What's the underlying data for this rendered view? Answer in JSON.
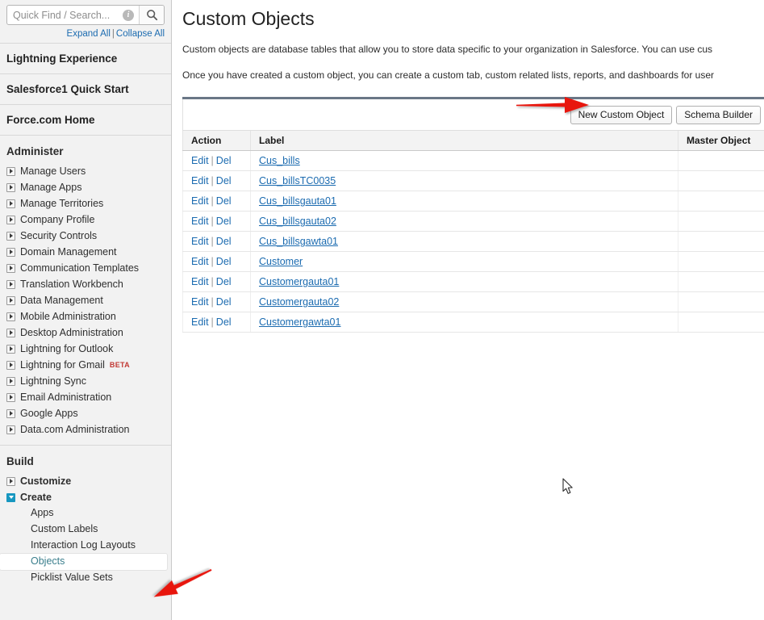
{
  "sidebar": {
    "search": {
      "placeholder": "Quick Find / Search...",
      "value": "",
      "info_icon": "info-circle-icon",
      "search_icon": "search-icon"
    },
    "expand_all": "Expand All",
    "collapse_all": "Collapse All",
    "separator": "|",
    "top_sections": [
      {
        "label": "Lightning Experience"
      },
      {
        "label": "Salesforce1 Quick Start"
      },
      {
        "label": "Force.com Home"
      }
    ],
    "groups": [
      {
        "title": "Administer",
        "items": [
          {
            "label": "Manage Users",
            "expanded": false
          },
          {
            "label": "Manage Apps",
            "expanded": false
          },
          {
            "label": "Manage Territories",
            "expanded": false
          },
          {
            "label": "Company Profile",
            "expanded": false
          },
          {
            "label": "Security Controls",
            "expanded": false
          },
          {
            "label": "Domain Management",
            "expanded": false
          },
          {
            "label": "Communication Templates",
            "expanded": false
          },
          {
            "label": "Translation Workbench",
            "expanded": false
          },
          {
            "label": "Data Management",
            "expanded": false
          },
          {
            "label": "Mobile Administration",
            "expanded": false
          },
          {
            "label": "Desktop Administration",
            "expanded": false
          },
          {
            "label": "Lightning for Outlook",
            "expanded": false
          },
          {
            "label": "Lightning for Gmail",
            "expanded": false,
            "badge": "BETA"
          },
          {
            "label": "Lightning Sync",
            "expanded": false
          },
          {
            "label": "Email Administration",
            "expanded": false
          },
          {
            "label": "Google Apps",
            "expanded": false
          },
          {
            "label": "Data.com Administration",
            "expanded": false
          }
        ]
      },
      {
        "title": "Build",
        "items": [
          {
            "label": "Customize",
            "expanded": false
          },
          {
            "label": "Create",
            "expanded": true
          }
        ],
        "sub_items": [
          {
            "label": "Apps",
            "selected": false
          },
          {
            "label": "Custom Labels",
            "selected": false
          },
          {
            "label": "Interaction Log Layouts",
            "selected": false
          },
          {
            "label": "Objects",
            "selected": true
          },
          {
            "label": "Picklist Value Sets",
            "selected": false
          }
        ]
      }
    ]
  },
  "main": {
    "title": "Custom Objects",
    "intro_line_1": "Custom objects are database tables that allow you to store data specific to your organization in Salesforce. You can use cus",
    "intro_line_2": "Once you have created a custom object, you can create a custom tab, custom related lists, reports, and dashboards for user",
    "toolbar": {
      "new_custom_object_label": "New Custom Object",
      "schema_builder_label": "Schema Builder"
    },
    "table": {
      "columns": [
        "Action",
        "Label",
        "Master Object"
      ],
      "rows": [
        {
          "edit": "Edit",
          "del": "Del",
          "label": "Cus_bills",
          "master": ""
        },
        {
          "edit": "Edit",
          "del": "Del",
          "label": "Cus_billsTC0035",
          "master": ""
        },
        {
          "edit": "Edit",
          "del": "Del",
          "label": "Cus_billsgauta01",
          "master": ""
        },
        {
          "edit": "Edit",
          "del": "Del",
          "label": "Cus_billsgauta02",
          "master": ""
        },
        {
          "edit": "Edit",
          "del": "Del",
          "label": "Cus_billsgawta01",
          "master": ""
        },
        {
          "edit": "Edit",
          "del": "Del",
          "label": "Customer",
          "master": ""
        },
        {
          "edit": "Edit",
          "del": "Del",
          "label": "Customergauta01",
          "master": ""
        },
        {
          "edit": "Edit",
          "del": "Del",
          "label": "Customergauta02",
          "master": ""
        },
        {
          "edit": "Edit",
          "del": "Del",
          "label": "Customergawta01",
          "master": ""
        }
      ]
    }
  },
  "annotations": {
    "color": "#e8140c",
    "arrow_new_object": "red-arrow-right-icon",
    "arrow_objects": "red-arrow-diagonal-icon"
  },
  "cursor": {
    "icon": "mouse-pointer-icon"
  }
}
